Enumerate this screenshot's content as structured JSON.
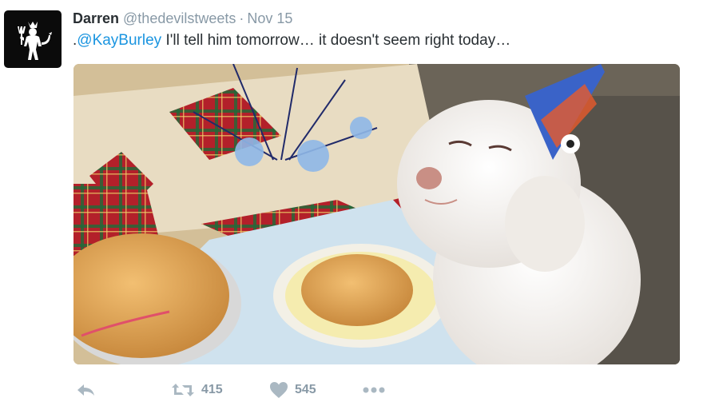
{
  "tweet": {
    "display_name": "Darren",
    "handle": "@thedevilstweets",
    "separator": "·",
    "date": "Nov 15",
    "text_prefix": ".",
    "mention": "@KayBurley",
    "text_body": " I'll tell him tomorrow… it doesn't seem right today…",
    "avatar_icon": "red-devil-logo-icon"
  },
  "actions": {
    "reply_icon": "reply-icon",
    "retweet_icon": "retweet-icon",
    "retweet_count": "415",
    "like_icon": "heart-icon",
    "like_count": "545",
    "more_icon": "more-dots-icon"
  },
  "colors": {
    "name": "#292f33",
    "meta": "#8899a6",
    "link": "#1b95e0",
    "action_icon": "#aab8c2"
  }
}
